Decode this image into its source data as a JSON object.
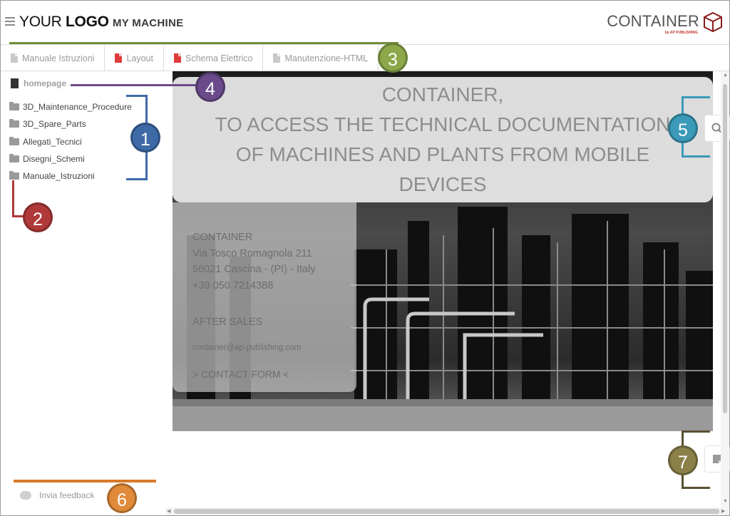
{
  "header": {
    "logo_regular": "YOUR",
    "logo_bold": "LOGO",
    "machine": "MY MACHINE",
    "brand": "CONTAINER",
    "brand_sub": "by AP PUBLISHING"
  },
  "tabs": [
    {
      "label": "Manuale Istruzioni",
      "icon": "document-icon"
    },
    {
      "label": "Layout",
      "icon": "pdf-icon"
    },
    {
      "label": "Schema Elettrico",
      "icon": "pdf-icon"
    },
    {
      "label": "Manutenzione-HTML",
      "icon": "document-icon"
    }
  ],
  "sidebar": {
    "home": "homepage",
    "items": [
      {
        "label": "3D_Maintenance_Procedure"
      },
      {
        "label": "3D_Spare_Parts"
      },
      {
        "label": "Allegati_Tecnici"
      },
      {
        "label": "Disegni_Schemi"
      },
      {
        "label": "Manuale_Istruzioni"
      }
    ],
    "feedback": "Invia feedback"
  },
  "content": {
    "headline": [
      "CONTAINER,",
      "TO ACCESS THE TECHNICAL DOCUMENTATION",
      "OF MACHINES AND PLANTS FROM MOBILE",
      "DEVICES"
    ],
    "address": [
      "CONTAINER",
      "Via Tosco Romagnola 211",
      "56021 Cascina - (PI) - Italy",
      "+39 050 7214388"
    ],
    "after_sales": "AFTER SALES",
    "email": "container@ap-publishing.com",
    "contact": "> CONTACT FORM <"
  },
  "callouts": {
    "c1": "1",
    "c2": "2",
    "c3": "3",
    "c4": "4",
    "c5": "5",
    "c6": "6",
    "c7": "7"
  },
  "colors": {
    "c1": "#3e6aa8",
    "c2": "#b03a3a",
    "c3": "#8ca84a",
    "c4": "#6a4a8a",
    "c5": "#3a9ab8",
    "c6": "#e08a3a",
    "c7": "#8a8048",
    "brand_accent": "#c0392b"
  }
}
